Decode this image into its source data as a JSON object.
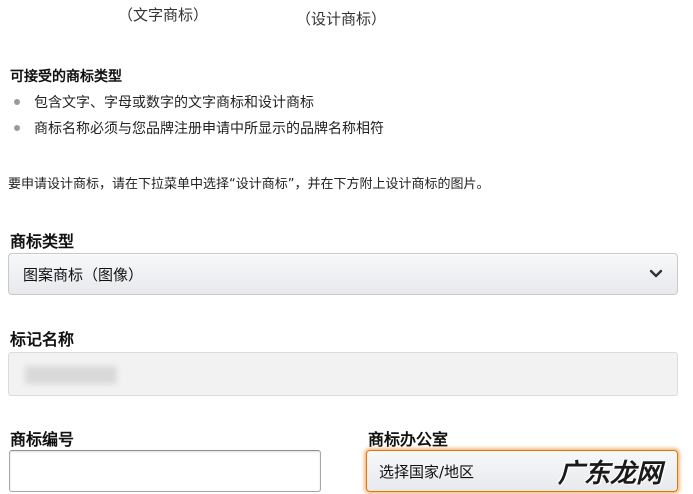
{
  "captions": {
    "word_mark": "（文字商标）",
    "design_mark": "（设计商标）"
  },
  "accepted_types": {
    "title": "可接受的商标类型",
    "bullets": [
      "包含文字、字母或数字的文字商标和设计商标",
      "商标名称必须与您品牌注册申请中所显示的品牌名称相符"
    ]
  },
  "instruction": "要申请设计商标，请在下拉菜单中选择“设计商标”，并在下方附上设计商标的图片。",
  "trademark_type": {
    "label": "商标类型",
    "selected": "图案商标（图像）"
  },
  "mark_name": {
    "label": "标记名称"
  },
  "trademark_number": {
    "label": "商标编号",
    "value": ""
  },
  "trademark_office": {
    "label": "商标办公室",
    "selected": "选择国家/地区"
  },
  "watermark": "广东龙网",
  "colors": {
    "focus_border": "#e77600",
    "select_gradient_top": "#f7f8fa",
    "select_gradient_bottom": "#e7e9ec"
  }
}
